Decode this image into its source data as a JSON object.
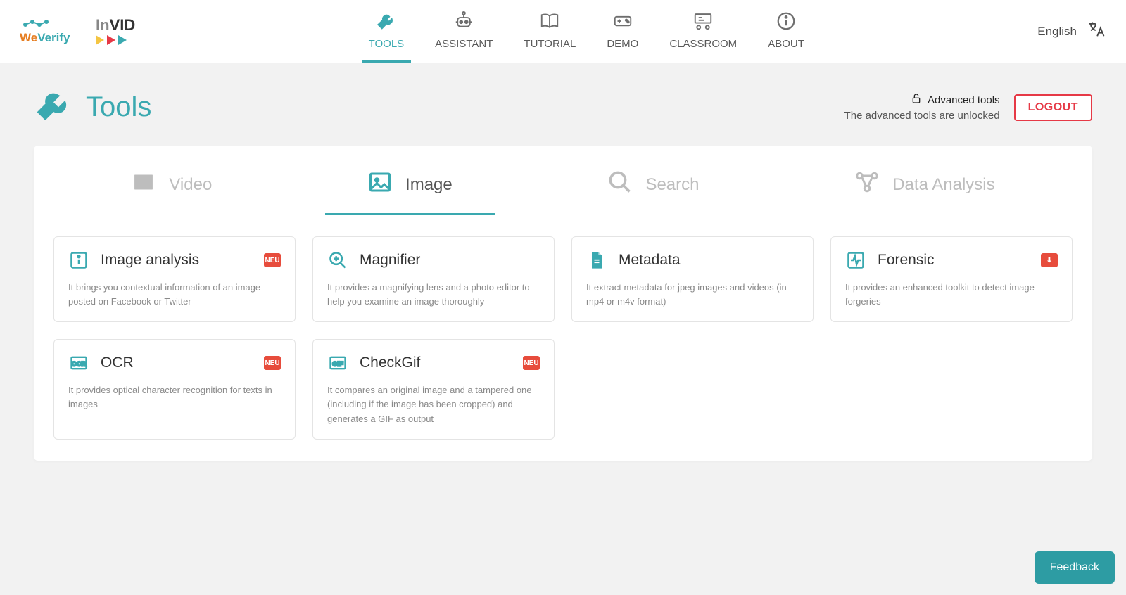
{
  "header": {
    "language_label": "English",
    "nav": [
      {
        "id": "tools",
        "label": "TOOLS",
        "active": true
      },
      {
        "id": "assistant",
        "label": "ASSISTANT",
        "active": false
      },
      {
        "id": "tutorial",
        "label": "TUTORIAL",
        "active": false
      },
      {
        "id": "demo",
        "label": "DEMO",
        "active": false
      },
      {
        "id": "classroom",
        "label": "CLASSROOM",
        "active": false
      },
      {
        "id": "about",
        "label": "ABOUT",
        "active": false
      }
    ],
    "logos": {
      "weverify": "WeVerify",
      "invid": "InVID"
    }
  },
  "page": {
    "title": "Tools",
    "advanced_label": "Advanced tools",
    "advanced_desc": "The advanced tools are unlocked",
    "logout": "LOGOUT"
  },
  "categories": [
    {
      "id": "video",
      "label": "Video",
      "active": false
    },
    {
      "id": "image",
      "label": "Image",
      "active": true
    },
    {
      "id": "search",
      "label": "Search",
      "active": false
    },
    {
      "id": "data",
      "label": "Data Analysis",
      "active": false
    }
  ],
  "cards": [
    {
      "id": "image-analysis",
      "title": "Image analysis",
      "desc": "It brings you contextual information of an image posted on Facebook or Twitter",
      "badge": "NEU"
    },
    {
      "id": "magnifier",
      "title": "Magnifier",
      "desc": "It provides a magnifying lens and a photo editor to help you examine an image thoroughly",
      "badge": ""
    },
    {
      "id": "metadata",
      "title": "Metadata",
      "desc": "It extract metadata for jpeg images and videos (in mp4 or m4v format)",
      "badge": ""
    },
    {
      "id": "forensic",
      "title": "Forensic",
      "desc": "It provides an enhanced toolkit to detect image forgeries",
      "badge": "LOCK"
    },
    {
      "id": "ocr",
      "title": "OCR",
      "desc": "It provides optical character recognition for texts in images",
      "badge": "NEU"
    },
    {
      "id": "checkgif",
      "title": "CheckGif",
      "desc": "It compares an original image and a tampered one (including if the image has been cropped) and generates a GIF as output",
      "badge": "NEU"
    }
  ],
  "feedback": "Feedback",
  "badge_text": {
    "NEU": "NEU",
    "LOCK": "⬇"
  }
}
